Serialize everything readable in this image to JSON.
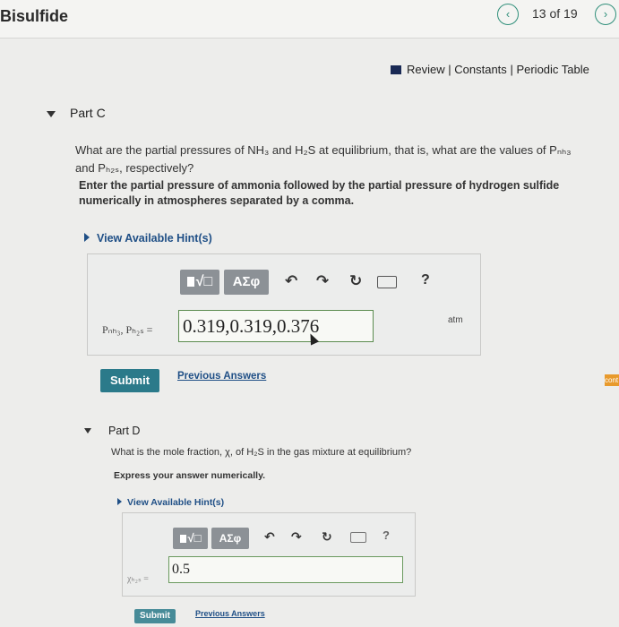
{
  "header": {
    "title": "Bisulfide",
    "page_count": "13 of 19",
    "prev_icon": "chevron-left-icon",
    "next_icon": "chevron-right-icon"
  },
  "reference_bar": {
    "review_label": "Review",
    "constants_label": "Constants",
    "periodic_table_label": "Periodic Table",
    "separator": "|"
  },
  "part_c": {
    "label": "Part C",
    "question_line1": "What are the partial pressures of NH₃ and H₂S at equilibrium, that is, what are the values of Pₙₕ₃",
    "question_line2": "and Pₕ₂ₛ, respectively?",
    "instruction_line1": "Enter the partial pressure of ammonia followed by the partial pressure of hydrogen sulfide",
    "instruction_line2": "numerically in atmospheres separated by a comma.",
    "hint_label": "View Available Hint(s)",
    "toolbar": {
      "template_label": "√□",
      "symbols_label": "ΑΣφ",
      "help_label": "?"
    },
    "variable_label": "Pₙₕ₃, Pₕ₂ₛ =",
    "answer_value": "0.319,0.319,0.376",
    "unit": "atm",
    "submit_label": "Submit",
    "previous_answers_label": "Previous Answers"
  },
  "part_d": {
    "label": "Part D",
    "question": "What is the mole fraction, χ, of H₂S in the gas mixture at equilibrium?",
    "instruction": "Express your answer numerically.",
    "hint_label": "View Available Hint(s)",
    "toolbar": {
      "template_label": "√□",
      "symbols_label": "ΑΣφ",
      "help_label": "?"
    },
    "variable_label": "χₕ₂ₛ =",
    "answer_value": "0.5",
    "submit_label": "Submit",
    "previous_answers_label": "Previous Answers"
  },
  "side_edge_label": "cont",
  "colors": {
    "accent": "#2b7a8a",
    "link": "#1f4f86",
    "side_tab": "#e89a2c"
  }
}
